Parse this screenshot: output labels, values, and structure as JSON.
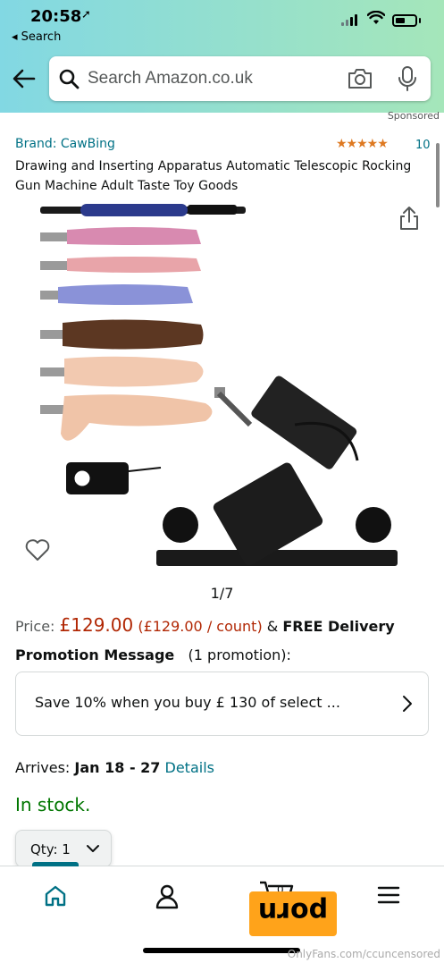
{
  "status_bar": {
    "time": "20:58",
    "location_arrow": "➚",
    "back_label": "◂ Search"
  },
  "search": {
    "placeholder": "Search Amazon.co.uk"
  },
  "product": {
    "sponsored": "Sponsored",
    "brand": "Brand: CawBing",
    "stars": "★★★★★",
    "rating_count": "10",
    "title": "Drawing and Inserting Apparatus Automatic Telescopic Rocking Gun Machine Adult Taste Toy Goods",
    "image_counter": "1/7"
  },
  "price": {
    "label": "Price: ",
    "value": "£129.00",
    "unit_price": " (£129.00 / count)",
    "amp": " & ",
    "free_delivery": "FREE Delivery"
  },
  "promotion": {
    "heading": "Promotion Message",
    "count": "(1 promotion):",
    "text": "Save 10% when you buy £ 130 of select ..."
  },
  "delivery": {
    "arrives_label": "Arrives: ",
    "date_range": "Jan 18 - 27",
    "details_link": "Details"
  },
  "stock": {
    "status": "In stock."
  },
  "quantity": {
    "label": "Qty: 1"
  },
  "bottom_nav": {
    "cart_count": "0"
  },
  "watermark": {
    "logo_text": "porn",
    "text": "OnlyFans.com/ccuncensored"
  },
  "colors": {
    "header_gradient_start": "#82d8e3",
    "header_gradient_end": "#a5e6ba",
    "link": "#007185",
    "price": "#b12704",
    "in_stock": "#007600",
    "stars": "#de7921"
  }
}
